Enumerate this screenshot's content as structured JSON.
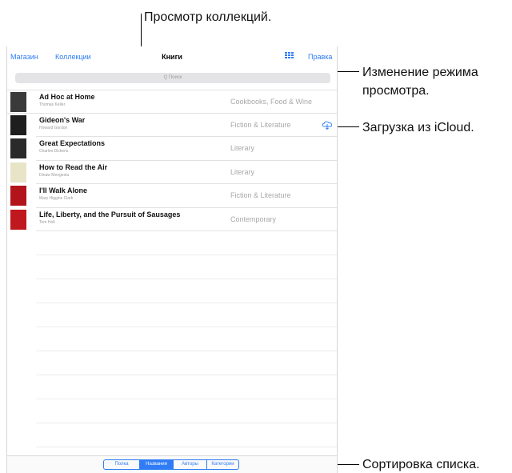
{
  "callouts": {
    "collections": "Просмотр коллекций.",
    "view_mode_line1": "Изменение режима",
    "view_mode_line2": "просмотра.",
    "icloud": "Загрузка из iCloud.",
    "sort": "Сортировка списка."
  },
  "navbar": {
    "store": "Магазин",
    "collections": "Коллекции",
    "title": "Книги",
    "grid_icon": "grid-view-icon",
    "edit": "Правка"
  },
  "search": {
    "placeholder": "Q Поиск"
  },
  "books": [
    {
      "title": "Ad Hoc at Home",
      "author": "Thomas Keller",
      "category": "Cookbooks, Food & Wine",
      "cover_color": "#3a3a3a"
    },
    {
      "title": "Gideon's War",
      "author": "Howard Gordon",
      "category": "Fiction & Literature",
      "cover_color": "#1e1e1e",
      "cloud": true
    },
    {
      "title": "Great Expectations",
      "author": "Charles Dickens",
      "category": "Literary",
      "cover_color": "#2a2a2a"
    },
    {
      "title": "How to Read the Air",
      "author": "Dinaw Mengestu",
      "category": "Literary",
      "cover_color": "#e8e4c8"
    },
    {
      "title": "I'll Walk Alone",
      "author": "Mary Higgins Clark",
      "category": "Fiction & Literature",
      "cover_color": "#b3141b"
    },
    {
      "title": "Life, Liberty, and the Pursuit of Sausages",
      "author": "Tom Holt",
      "category": "Contemporary",
      "cover_color": "#c0181f"
    }
  ],
  "sort_tabs": [
    {
      "label": "Полка",
      "active": false
    },
    {
      "label": "Названия",
      "active": true
    },
    {
      "label": "Авторы",
      "active": false
    },
    {
      "label": "Категории",
      "active": false
    }
  ],
  "colors": {
    "accent": "#2f7cf6"
  }
}
